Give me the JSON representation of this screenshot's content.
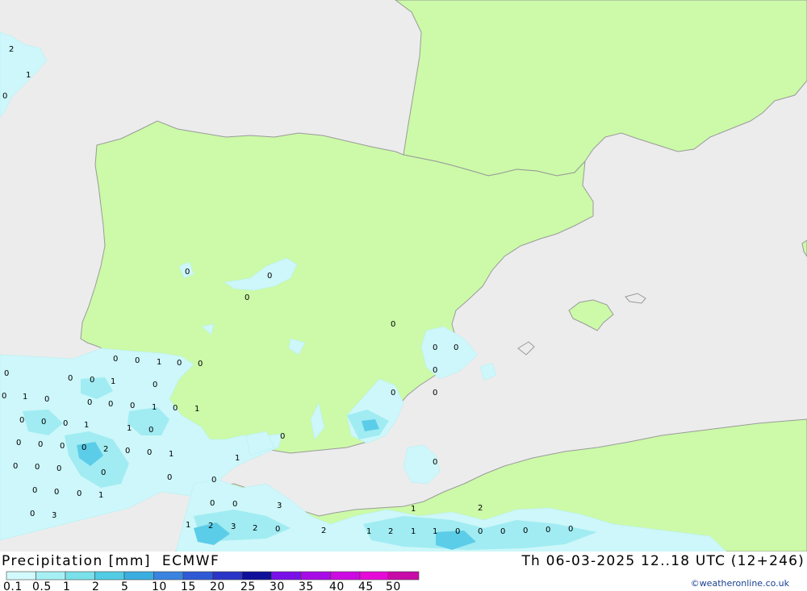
{
  "title": {
    "left": "Precipitation [mm]  ECMWF",
    "right": "Th 06-03-2025 12..18 UTC (12+246)"
  },
  "credit": "©weatheronline.co.uk",
  "colors": {
    "sea": "#ececec",
    "land": "#ccfaa8",
    "coast": "#9a9a9a",
    "precip_light": "#cdf7fa",
    "precip_mid": "#a0ecf2",
    "precip_heavy": "#5ccde8"
  },
  "legend": {
    "labels": [
      "0.1",
      "0.5",
      "1",
      "2",
      "5",
      "10",
      "15",
      "20",
      "25",
      "30",
      "35",
      "40",
      "45",
      "50"
    ],
    "colors": [
      "#d2fafc",
      "#a6f0f4",
      "#7ae0ea",
      "#52cce4",
      "#3aaee0",
      "#3a84e0",
      "#2f5ad6",
      "#2a34c6",
      "#10109a",
      "#7a10e8",
      "#a80ce6",
      "#cc0ae2",
      "#e60ad8",
      "#c80aa8"
    ]
  },
  "precip_values": [
    "2",
    "1",
    "0",
    "0",
    "0",
    "0",
    "0",
    "0",
    "0",
    "0",
    "0",
    "0",
    "0",
    "0",
    "1",
    "0",
    "0",
    "0",
    "0",
    "0",
    "1",
    "0",
    "0",
    "1",
    "0",
    "0",
    "0",
    "0",
    "1",
    "0",
    "1",
    "0",
    "0",
    "0",
    "1",
    "1",
    "0",
    "0",
    "0",
    "0",
    "0",
    "2",
    "0",
    "0",
    "1",
    "0",
    "1",
    "0",
    "0",
    "0",
    "0",
    "0",
    "0",
    "0",
    "0",
    "0",
    "1",
    "0",
    "0",
    "3",
    "0",
    "0",
    "3",
    "2",
    "3",
    "2",
    "0",
    "1",
    "2",
    "1",
    "2",
    "1",
    "1",
    "0",
    "0",
    "0",
    "0",
    "0",
    "0",
    "1",
    "2"
  ]
}
